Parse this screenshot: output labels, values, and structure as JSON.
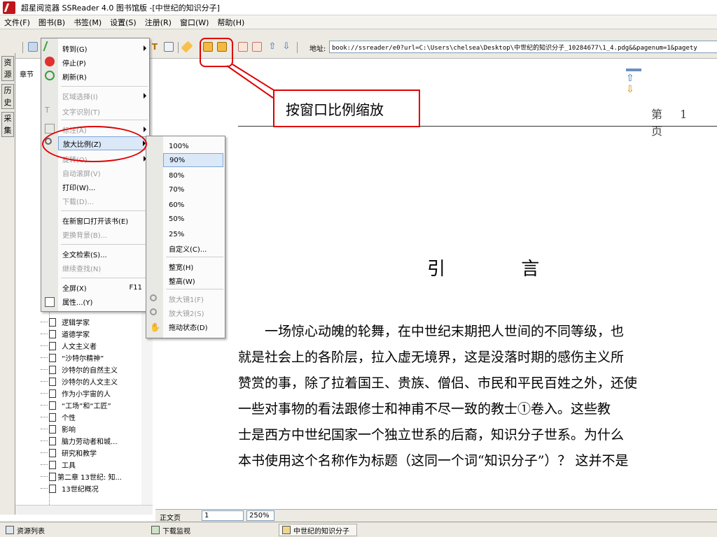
{
  "window": {
    "title": "超星阅览器 SSReader 4.0 图书馆版 -[中世纪的知识分子]"
  },
  "menubar": [
    "文件(F)",
    "图书(B)",
    "书签(M)",
    "设置(S)",
    "注册(R)",
    "窗口(W)",
    "帮助(H)"
  ],
  "toolbar": {
    "address_label": "地址:",
    "address_value": "book://ssreader/e0?url=C:\\Users\\chelsea\\Desktop\\中世纪的知识分子_10284677\\1_4.pdg&&pagenum=1&pagety"
  },
  "vtabs": [
    "资源",
    "历史",
    "采集"
  ],
  "left_panel": {
    "tab_label": "章节",
    "tree_items": [
      "逻辑学家",
      "道德学家",
      "人文主义者",
      "“沙特尔精神”",
      "沙特尔的自然主义",
      "沙特尔的人文主义",
      "作为小宇宙的人",
      "“工场”和“工匠”",
      "个性",
      "影响",
      "脑力劳动者和城...",
      "研究和教学",
      "工具",
      "第二章  13世纪: 知...",
      "13世纪概况"
    ]
  },
  "menu_primary": {
    "items": [
      {
        "label": "转到(G)",
        "submenu": true,
        "disabled": false
      },
      {
        "label": "停止(P)",
        "disabled": false
      },
      {
        "label": "刷新(R)",
        "disabled": false
      },
      {
        "label": "区域选择(I)",
        "submenu": true,
        "disabled": true
      },
      {
        "label": "文字识别(T)",
        "disabled": true
      },
      {
        "label": "标注(A)",
        "submenu": true,
        "disabled": true
      },
      {
        "label": "放大比例(Z)",
        "submenu": true,
        "highlighted": true
      },
      {
        "label": "旋转(O)",
        "submenu": true,
        "disabled": true
      },
      {
        "label": "自动滚屏(V)",
        "disabled": true
      },
      {
        "label": "打印(W)...",
        "disabled": false
      },
      {
        "label": "下载(D)...",
        "disabled": true
      },
      {
        "label": "在新窗口打开该书(E)",
        "disabled": false
      },
      {
        "label": "更换背景(B)...",
        "disabled": true
      },
      {
        "label": "全文检索(S)...",
        "disabled": false
      },
      {
        "label": "继续查找(N)",
        "disabled": true
      },
      {
        "label": "全屏(X)",
        "shortcut": "F11",
        "disabled": false
      },
      {
        "label": "属性...(Y)",
        "disabled": false
      }
    ]
  },
  "menu_zoom": {
    "items": [
      {
        "label": "100%"
      },
      {
        "label": "90%",
        "highlighted": true
      },
      {
        "label": "80%"
      },
      {
        "label": "70%"
      },
      {
        "label": "60%"
      },
      {
        "label": "50%"
      },
      {
        "label": "25%"
      },
      {
        "label": "自定义(C)..."
      },
      {
        "label": "整宽(H)"
      },
      {
        "label": "整高(W)"
      },
      {
        "label": "放大镜1(F)",
        "disabled": true
      },
      {
        "label": "放大镜2(S)",
        "disabled": true
      },
      {
        "label": "拖动状态(D)"
      }
    ]
  },
  "callout": {
    "text": "按窗口比例缩放"
  },
  "page": {
    "page_number": "第 1 页",
    "chapter_title": "引 言",
    "paragraph_lines": [
      "　　一场惊心动魄的轮舞，在中世纪末期把人世间的不同等级，也",
      "就是社会上的各阶层，拉入虚无境界，这是没落时期的感伤主义所",
      "赞赏的事，除了拉着国王、贵族、僧侣、市民和平民百姓之外，还使",
      "一些对事物的看法跟修士和神甫不尽一致的教士①卷入。这些教",
      "士是西方中世纪国家一个独立世系的后裔，知识分子世系。为什么",
      "本书使用这个名称作为标题（这同一个词“知识分子”）？ 这并不是"
    ]
  },
  "nav_bar": {
    "section": "正文页",
    "page_input": "1",
    "zoom": "250%"
  },
  "statusbar": {
    "resource_list": "资源列表",
    "download_monitor": "下载监视",
    "book_tab": "中世纪的知识分子"
  }
}
